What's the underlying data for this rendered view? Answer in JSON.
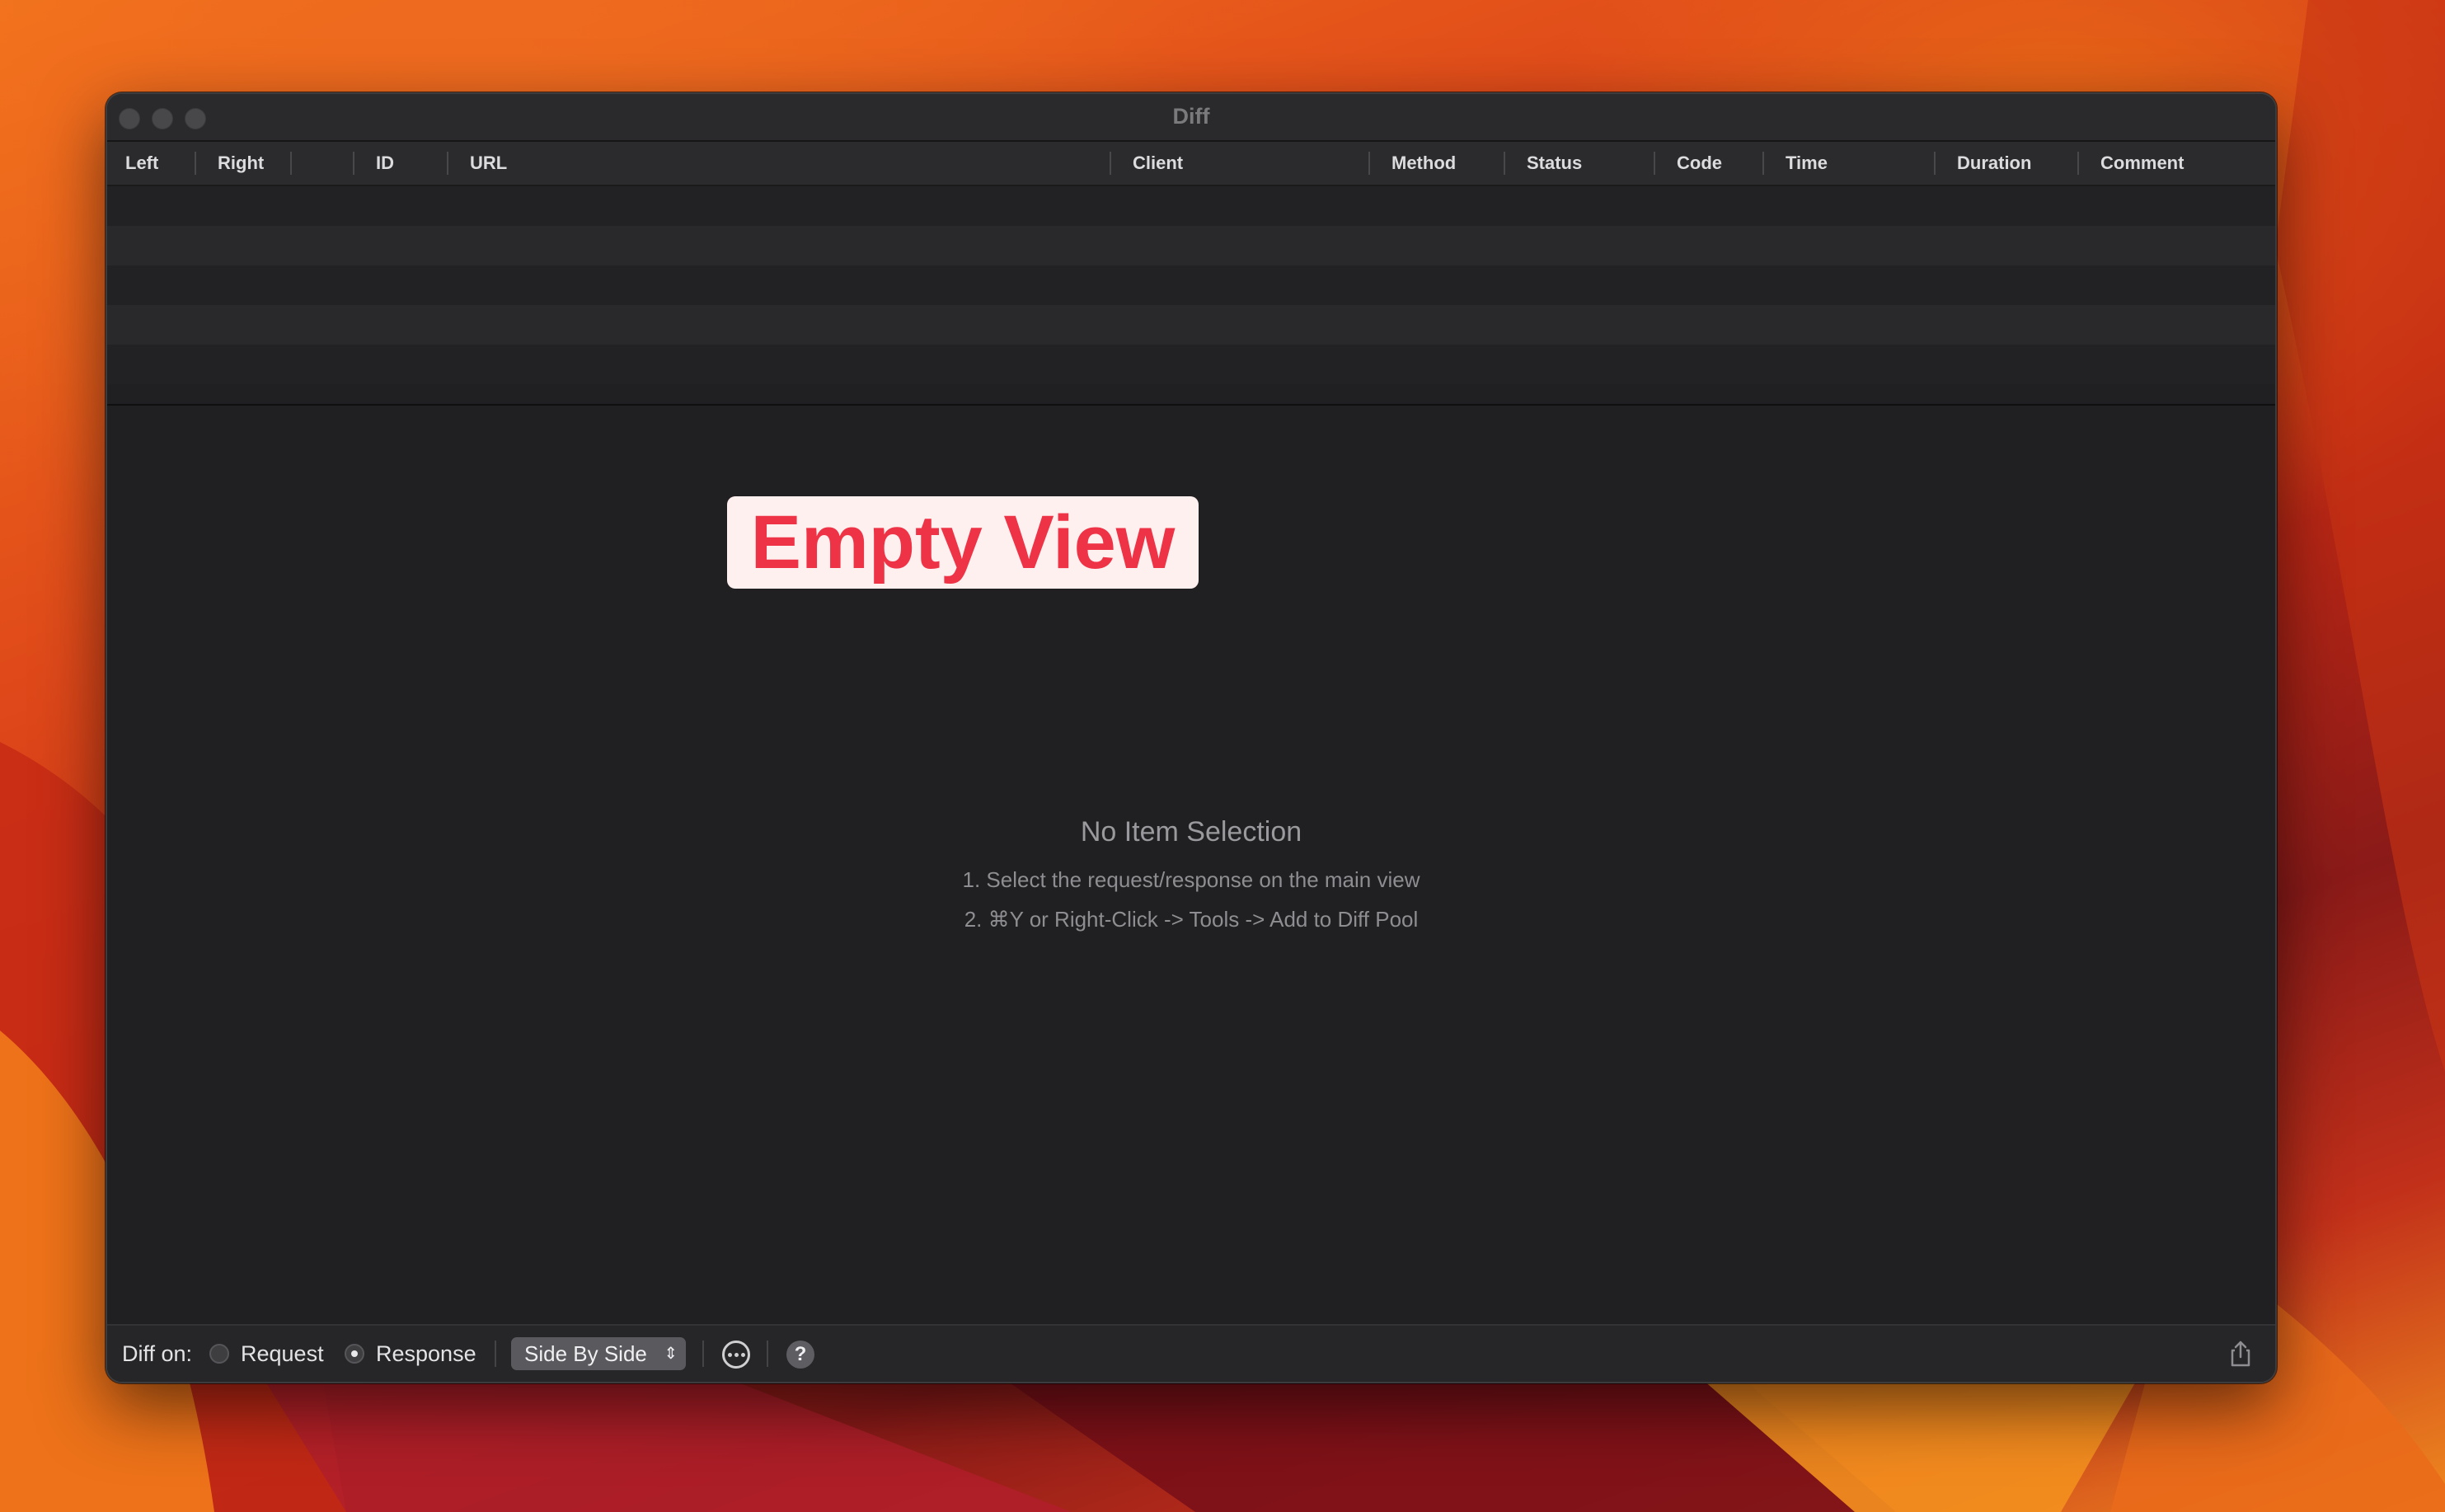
{
  "window": {
    "title": "Diff"
  },
  "table": {
    "columns": [
      "Left",
      "Right",
      "",
      "ID",
      "URL",
      "Client",
      "Method",
      "Status",
      "Code",
      "Time",
      "Duration",
      "Comment"
    ]
  },
  "empty_badge": "Empty View",
  "empty_state": {
    "title": "No Item Selection",
    "line1": "1. Select the request/response on the main view",
    "line2": "2. ⌘Y or Right-Click -> Tools -> Add to Diff Pool"
  },
  "bottom_bar": {
    "diff_on_label": "Diff on:",
    "request_label": "Request",
    "response_label": "Response",
    "selected": "Response",
    "mode_value": "Side By Side",
    "help_label": "?"
  },
  "icons": {
    "more": "ellipsis-circle-icon",
    "help": "question-circle-icon",
    "share": "share-icon",
    "mode_chevron": "chevron-up-down-icon"
  }
}
